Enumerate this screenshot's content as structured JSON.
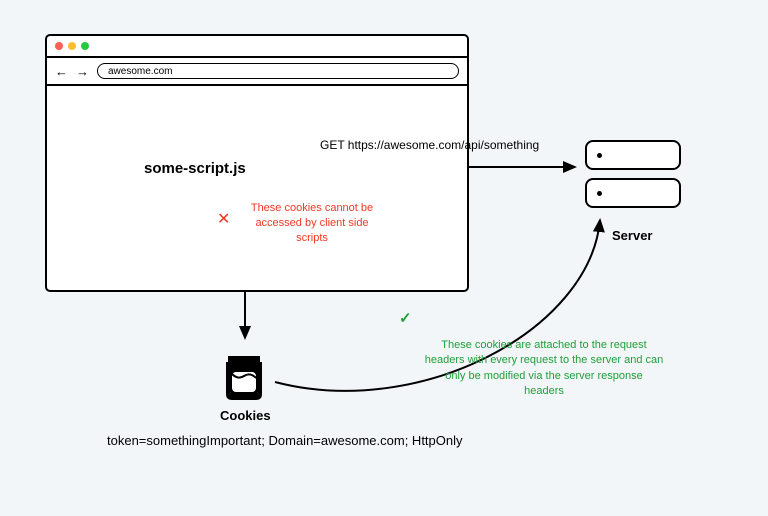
{
  "browser": {
    "url": "awesome.com",
    "backArrow": "←",
    "forwardArrow": "→"
  },
  "script": {
    "name": "some-script.js"
  },
  "request": {
    "label": "GET  https://awesome.com/api/something"
  },
  "server": {
    "label": "Server"
  },
  "redNote": {
    "x": "✕",
    "text": "These cookies cannot be accessed by client side scripts"
  },
  "greenNote": {
    "check": "✓",
    "text": "These cookies are attached to the request headers with every request to the server and can only be modified via the server response headers"
  },
  "cookies": {
    "label": "Cookies",
    "value": "token=somethingImportant; Domain=awesome.com; HttpOnly"
  }
}
